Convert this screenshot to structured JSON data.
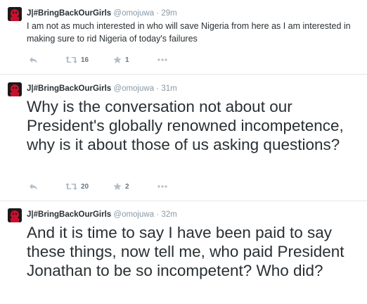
{
  "tweets": [
    {
      "name": "J|#BringBackOurGirls",
      "handle": "@omojuwa",
      "separator": "·",
      "time": "29m",
      "text": "I am not as much interested in who will save Nigeria from here as I am interested in making sure to rid Nigeria of today's failures",
      "retweets": "16",
      "favorites": "1"
    },
    {
      "name": "J|#BringBackOurGirls",
      "handle": "@omojuwa",
      "separator": "·",
      "time": "31m",
      "text": "Why is the conversation not about our President's globally renowned incompetence, why is it about those of us asking questions?",
      "retweets": "20",
      "favorites": "2"
    },
    {
      "name": "J|#BringBackOurGirls",
      "handle": "@omojuwa",
      "separator": "·",
      "time": "32m",
      "text": "And it is time to say I have been paid to say these things, now tell me, who paid President Jonathan to be so incompetent? Who did?"
    }
  ],
  "icons": {
    "reply": "reply-icon",
    "retweet": "retweet-icon",
    "favorite": "star-icon",
    "more": "more-icon",
    "avatar": "avatar"
  },
  "colors": {
    "name": "#292f33",
    "meta": "#8899a6",
    "divider": "#e1e8ed",
    "avatar_bg": "#1a1a1a",
    "avatar_accent": "#c8102e"
  }
}
